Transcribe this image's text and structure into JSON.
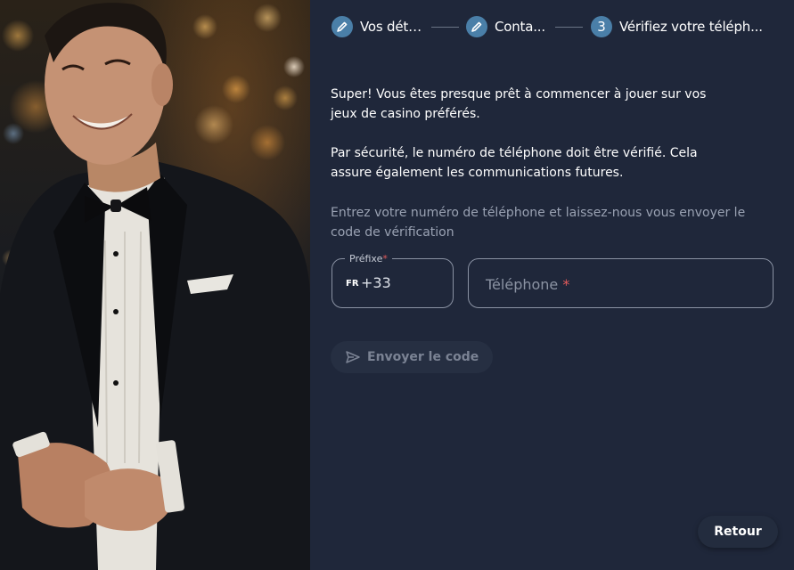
{
  "stepper": {
    "steps": [
      {
        "label": "Vos déta...",
        "state": "completed",
        "icon": "pencil-icon"
      },
      {
        "label": "Conta...",
        "state": "completed",
        "icon": "pencil-icon"
      },
      {
        "label": "Vérifiez votre téléph...",
        "state": "active",
        "number": "3"
      }
    ]
  },
  "content": {
    "intro": "Super! Vous êtes presque prêt à commencer à jouer sur vos jeux de casino préférés.",
    "security": "Par sécurité, le numéro de téléphone doit être vérifié. Cela assure également les communications futures.",
    "instruction": "Entrez votre numéro de téléphone et laissez-nous vous envoyer le code de vérification"
  },
  "form": {
    "prefix": {
      "label": "Préfixe",
      "required_mark": "*",
      "country_code": "FR",
      "value": "+33"
    },
    "phone": {
      "placeholder": "Téléphone",
      "required_mark": "*",
      "value": ""
    }
  },
  "actions": {
    "send_code": "Envoyer le code",
    "back": "Retour"
  },
  "colors": {
    "panel_bg": "#1f273a",
    "step_badge": "#4a7fa8",
    "required": "#e35b5b",
    "muted_text": "#9aa2b3"
  }
}
